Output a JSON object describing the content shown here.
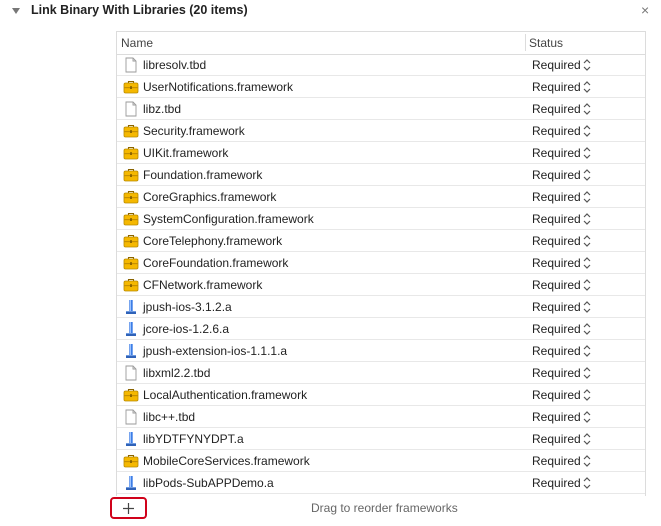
{
  "section": {
    "title": "Link Binary With Libraries (20 items)",
    "close_glyph": "×"
  },
  "table": {
    "columns": {
      "name": "Name",
      "status": "Status"
    },
    "rows": [
      {
        "name": "libresolv.tbd",
        "icon": "tbd-file-icon",
        "status": "Required"
      },
      {
        "name": "UserNotifications.framework",
        "icon": "framework-toolbox-icon",
        "status": "Required"
      },
      {
        "name": "libz.tbd",
        "icon": "tbd-file-icon",
        "status": "Required"
      },
      {
        "name": "Security.framework",
        "icon": "framework-toolbox-icon",
        "status": "Required"
      },
      {
        "name": "UIKit.framework",
        "icon": "framework-toolbox-icon",
        "status": "Required"
      },
      {
        "name": "Foundation.framework",
        "icon": "framework-toolbox-icon",
        "status": "Required"
      },
      {
        "name": "CoreGraphics.framework",
        "icon": "framework-toolbox-icon",
        "status": "Required"
      },
      {
        "name": "SystemConfiguration.framework",
        "icon": "framework-toolbox-icon",
        "status": "Required"
      },
      {
        "name": "CoreTelephony.framework",
        "icon": "framework-toolbox-icon",
        "status": "Required"
      },
      {
        "name": "CoreFoundation.framework",
        "icon": "framework-toolbox-icon",
        "status": "Required"
      },
      {
        "name": "CFNetwork.framework",
        "icon": "framework-toolbox-icon",
        "status": "Required"
      },
      {
        "name": "jpush-ios-3.1.2.a",
        "icon": "static-library-icon",
        "status": "Required"
      },
      {
        "name": "jcore-ios-1.2.6.a",
        "icon": "static-library-icon",
        "status": "Required"
      },
      {
        "name": "jpush-extension-ios-1.1.1.a",
        "icon": "static-library-icon",
        "status": "Required"
      },
      {
        "name": "libxml2.2.tbd",
        "icon": "tbd-file-icon",
        "status": "Required"
      },
      {
        "name": "LocalAuthentication.framework",
        "icon": "framework-toolbox-icon",
        "status": "Required"
      },
      {
        "name": "libc++.tbd",
        "icon": "tbd-file-icon",
        "status": "Required"
      },
      {
        "name": "libYDTFYNYDPT.a",
        "icon": "static-library-icon",
        "status": "Required"
      },
      {
        "name": "MobileCoreServices.framework",
        "icon": "framework-toolbox-icon",
        "status": "Required"
      },
      {
        "name": "libPods-SubAPPDemo.a",
        "icon": "static-library-icon",
        "status": "Required"
      }
    ]
  },
  "footer": {
    "add_glyph": "+",
    "remove_glyph": "−",
    "hint": "Drag to reorder frameworks"
  },
  "colors": {
    "highlight": "#d0021b",
    "framework_fill": "#f5b800",
    "lib_blue": "#3d7ee6"
  }
}
